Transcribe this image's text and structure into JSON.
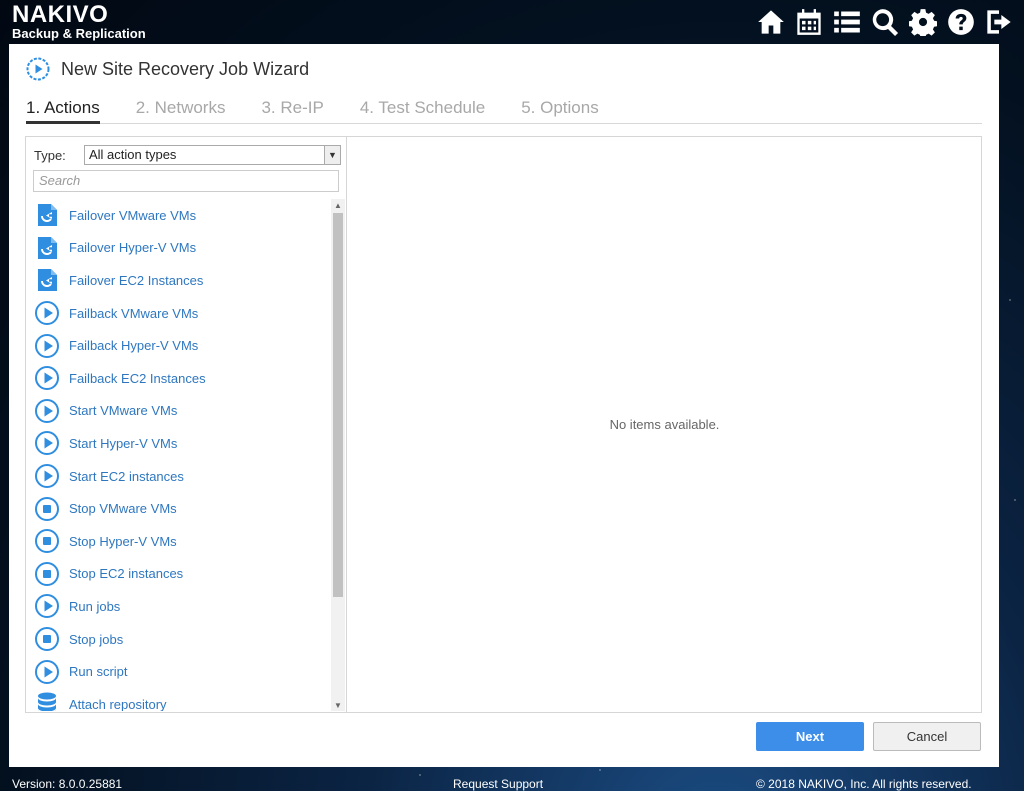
{
  "brand": {
    "name": "NAKIVO",
    "subtitle": "Backup & Replication"
  },
  "topbar": {
    "icons": [
      {
        "name": "home-icon"
      },
      {
        "name": "calendar-icon"
      },
      {
        "name": "list-icon"
      },
      {
        "name": "search-icon"
      },
      {
        "name": "gear-icon"
      },
      {
        "name": "help-icon"
      },
      {
        "name": "logout-icon"
      }
    ]
  },
  "wizard": {
    "title": "New Site Recovery Job Wizard",
    "steps": [
      "1. Actions",
      "2. Networks",
      "3. Re-IP",
      "4. Test Schedule",
      "5. Options"
    ],
    "active_step": 0
  },
  "filter": {
    "type_label": "Type:",
    "type_value": "All action types",
    "search_placeholder": "Search"
  },
  "actions": [
    {
      "label": "Failover VMware VMs",
      "icon": "failover-icon"
    },
    {
      "label": "Failover Hyper-V VMs",
      "icon": "failover-icon"
    },
    {
      "label": "Failover EC2 Instances",
      "icon": "failover-icon"
    },
    {
      "label": "Failback VMware VMs",
      "icon": "play-icon"
    },
    {
      "label": "Failback Hyper-V VMs",
      "icon": "play-icon"
    },
    {
      "label": "Failback EC2 Instances",
      "icon": "play-icon"
    },
    {
      "label": "Start VMware VMs",
      "icon": "play-icon"
    },
    {
      "label": "Start Hyper-V VMs",
      "icon": "play-icon"
    },
    {
      "label": "Start EC2 instances",
      "icon": "play-icon"
    },
    {
      "label": "Stop VMware VMs",
      "icon": "stop-icon"
    },
    {
      "label": "Stop Hyper-V VMs",
      "icon": "stop-icon"
    },
    {
      "label": "Stop EC2 instances",
      "icon": "stop-icon"
    },
    {
      "label": "Run jobs",
      "icon": "play-icon"
    },
    {
      "label": "Stop jobs",
      "icon": "stop-icon"
    },
    {
      "label": "Run script",
      "icon": "play-icon"
    },
    {
      "label": "Attach repository",
      "icon": "database-icon"
    }
  ],
  "details": {
    "empty_text": "No items available."
  },
  "buttons": {
    "next": "Next",
    "cancel": "Cancel"
  },
  "footer": {
    "version": "Version: 8.0.0.25881",
    "support": "Request Support",
    "copyright": "© 2018 NAKIVO, Inc. All rights reserved."
  },
  "colors": {
    "accent": "#3c8ee8",
    "link": "#2e77c0",
    "icon": "#2f8ee0"
  }
}
